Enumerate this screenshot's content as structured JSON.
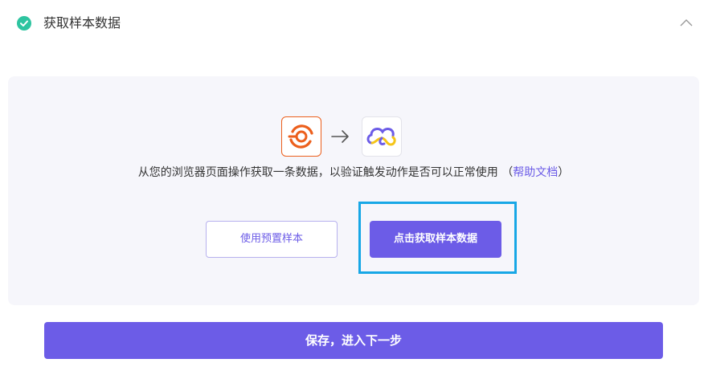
{
  "section": {
    "title": "获取样本数据",
    "status_icon": "check-circle-icon",
    "collapse_icon": "chevron-up-icon"
  },
  "flow": {
    "source_icon": "browser-automation-logo-icon",
    "arrow_icon": "arrow-right-icon",
    "target_icon": "cloud-app-logo-icon",
    "description": "从您的浏览器页面操作获取一条数据，以验证触发动作是否可以正常使用",
    "help_open": "（",
    "help_link": "帮助文档",
    "help_close": "）"
  },
  "actions": {
    "preset_label": "使用预置样本",
    "fetch_label": "点击获取样本数据"
  },
  "footer": {
    "save_label": "保存，进入下一步"
  },
  "colors": {
    "accent": "#6c5ce7",
    "success": "#2ec4a0",
    "highlight": "#17a7e6",
    "source_logo": "#ec5f1c"
  }
}
